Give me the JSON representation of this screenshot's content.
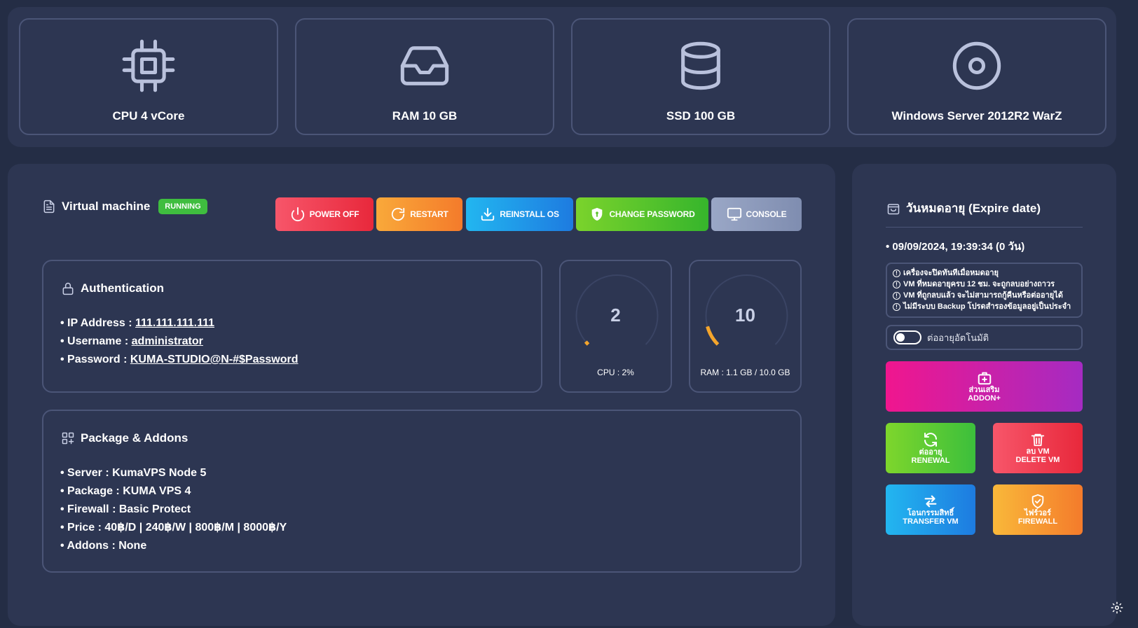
{
  "specs": [
    {
      "label": "CPU 4 vCore",
      "icon": "cpu-icon"
    },
    {
      "label": "RAM 10 GB",
      "icon": "inbox-icon"
    },
    {
      "label": "SSD 100 GB",
      "icon": "database-icon"
    },
    {
      "label": "Windows Server 2012R2 WarZ",
      "icon": "disc-icon"
    }
  ],
  "vm": {
    "title": "Virtual machine",
    "status": "RUNNING",
    "status_color": "#3fbd3f"
  },
  "actions": {
    "power_off": "POWER OFF",
    "restart": "RESTART",
    "reinstall": "REINSTALL OS",
    "change_password": "CHANGE PASSWORD",
    "console": "CONSOLE"
  },
  "auth": {
    "title": "Authentication",
    "ip_label": "• IP Address : ",
    "ip_value": "111.111.111.111",
    "user_label": "• Username : ",
    "user_value": "administrator",
    "pass_label": "• Password : ",
    "pass_value": "KUMA-STUDIO@N-#$Password"
  },
  "gauges": {
    "cpu": {
      "value": "2",
      "caption": "CPU : 2%",
      "percent": 2
    },
    "ram": {
      "value": "10",
      "caption": "RAM : 1.1 GB / 10.0 GB",
      "percent": 11
    }
  },
  "package": {
    "title": "Package & Addons",
    "lines": [
      "• Server : KumaVPS Node 5",
      "• Package : KUMA VPS 4",
      "• Firewall : Basic Protect",
      "• Price : 40฿/D | 240฿/W | 800฿/M | 8000฿/Y",
      "• Addons : None"
    ]
  },
  "expire": {
    "title": "วันหมดอายุ (Expire date)",
    "date": "• 09/09/2024, 19:39:34 (0 วัน)",
    "notices": [
      "เครื่องจะปิดทันทีเมื่อหมดอายุ",
      "VM ที่หมดอายุครบ 12 ชม. จะถูกลบอย่างถาวร",
      "VM ที่ถูกลบแล้ว จะไม่สามารถกู้คืนหรือต่ออายุได้",
      "ไม่มีระบบ Backup โปรดสำรองข้อมูลอยู่เป็นประจำ"
    ],
    "auto_renew_label": "ต่ออายุอัตโนมัติ"
  },
  "side_buttons": {
    "addon_th": "ส่วนเสริม",
    "addon_en": "ADDON+",
    "renew_th": "ต่ออายุ",
    "renew_en": "RENEWAL",
    "delete_th": "ลบ VM",
    "delete_en": "DELETE VM",
    "transfer_th": "โอนกรรมสิทธิ์",
    "transfer_en": "TRANSFER VM",
    "firewall_th": "ไฟร์วอร์",
    "firewall_en": "FIREWALL"
  }
}
